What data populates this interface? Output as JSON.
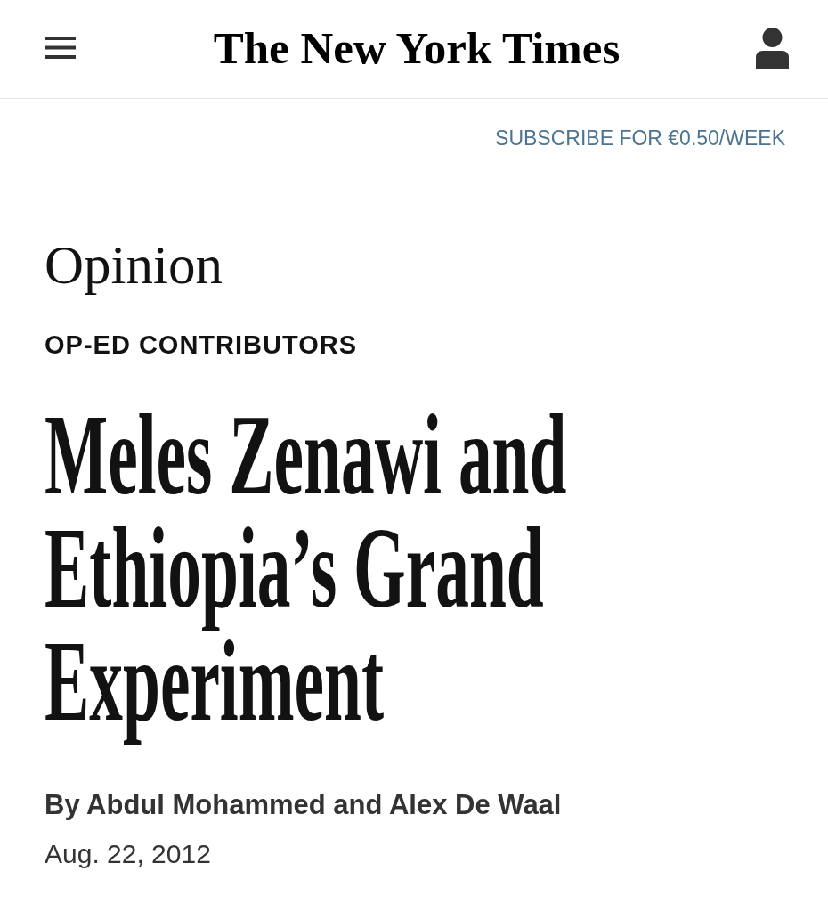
{
  "header": {
    "logo": "The New York Times"
  },
  "subscribe": "SUBSCRIBE FOR €0.50/WEEK",
  "section": "Opinion",
  "kicker": "OP-ED CONTRIBUTORS",
  "headline": "Meles Zenawi and Ethiopia’s Grand Experiment",
  "byline": "By Abdul Mohammed and Alex De Waal",
  "date": "Aug. 22, 2012"
}
